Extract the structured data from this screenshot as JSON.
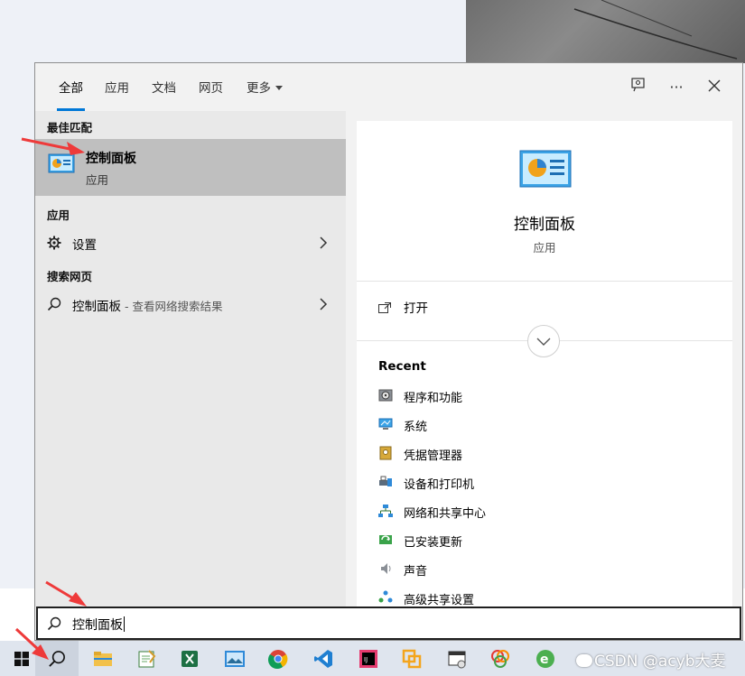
{
  "tabs": [
    {
      "label": "全部",
      "active": true
    },
    {
      "label": "应用"
    },
    {
      "label": "文档"
    },
    {
      "label": "网页"
    },
    {
      "label": "更多"
    }
  ],
  "top_buttons": {
    "feedback": "feedback-icon",
    "more": "···",
    "close": "×"
  },
  "left": {
    "best_match_header": "最佳匹配",
    "best_match": {
      "title": "控制面板",
      "subtitle": "应用"
    },
    "apps_header": "应用",
    "apps": [
      {
        "label": "设置"
      }
    ],
    "web_header": "搜索网页",
    "web": [
      {
        "label": "控制面板",
        "suffix": " - 查看网络搜索结果"
      }
    ]
  },
  "right": {
    "title": "控制面板",
    "subtitle": "应用",
    "open_label": "打开",
    "recent_header": "Recent",
    "recent": [
      {
        "label": "程序和功能"
      },
      {
        "label": "系统"
      },
      {
        "label": "凭据管理器"
      },
      {
        "label": "设备和打印机"
      },
      {
        "label": "网络和共享中心"
      },
      {
        "label": "已安装更新"
      },
      {
        "label": "声音"
      },
      {
        "label": "高级共享设置"
      }
    ]
  },
  "search": {
    "value": "控制面板"
  },
  "watermark": "CSDN @acyb大麦",
  "colors": {
    "accent": "#0078d7",
    "best_match_bg": "#bfbfbf",
    "arrow": "#ee3a3a"
  }
}
